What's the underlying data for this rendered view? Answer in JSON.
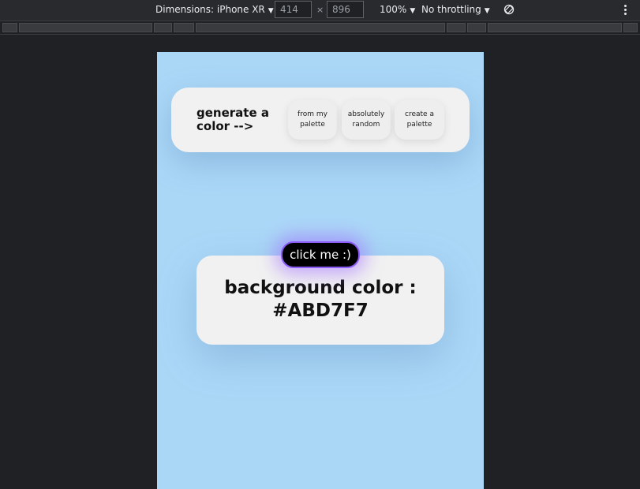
{
  "devtools": {
    "dimensions_label": "Dimensions: iPhone XR",
    "width_value": "414",
    "height_value": "896",
    "times": "×",
    "zoom": "100%",
    "throttling": "No throttling"
  },
  "page": {
    "background_color": "#ABD7F7",
    "generate": {
      "title": "generate a color -->",
      "buttons": [
        {
          "label": "from my palette"
        },
        {
          "label": "absolutely random"
        },
        {
          "label": "create a palette"
        }
      ]
    },
    "click_button_label": "click me :)",
    "color_display": "background color : #ABD7F7"
  },
  "colors": {
    "accent": "#8b5cf6",
    "card": "#f1f1f1",
    "devtools_bg": "#202124"
  }
}
